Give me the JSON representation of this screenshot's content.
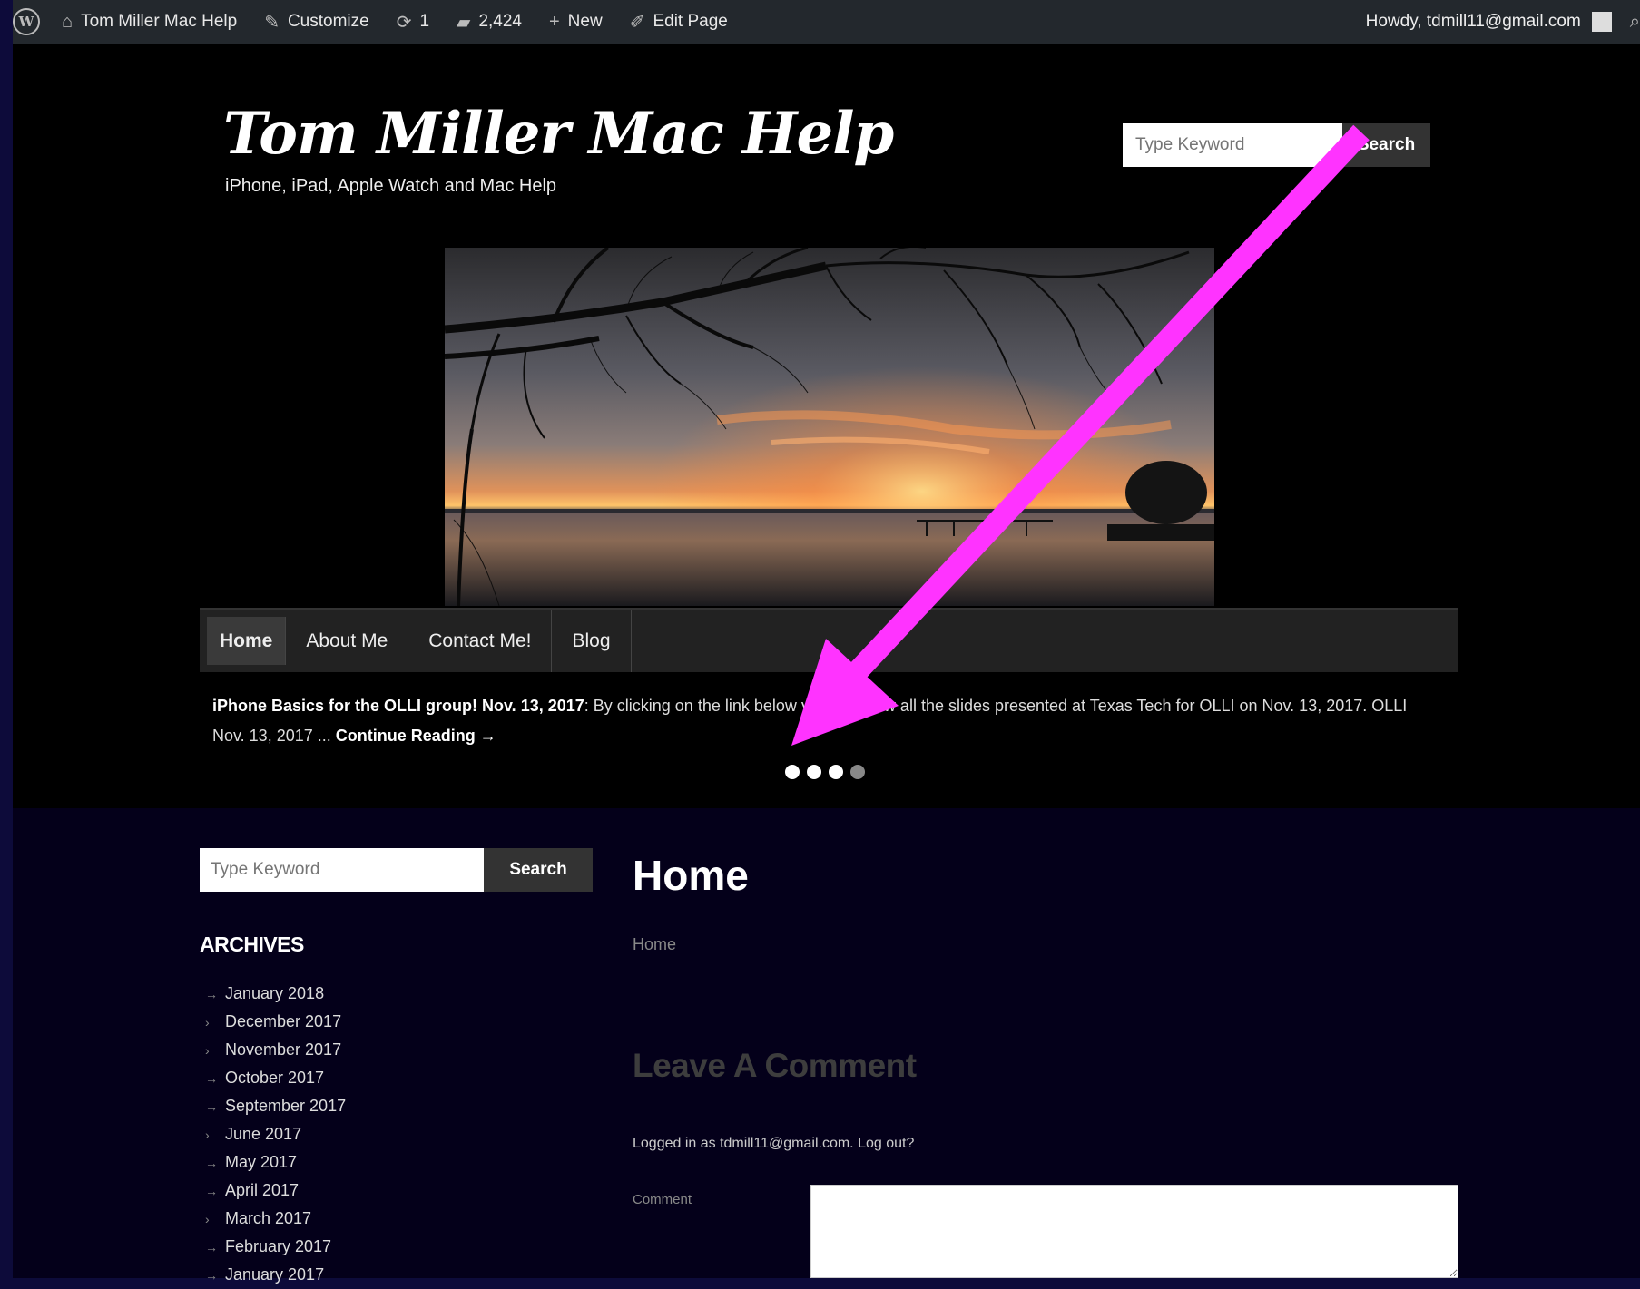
{
  "adminbar": {
    "site_name": "Tom Miller Mac Help",
    "customize": "Customize",
    "updates": "1",
    "comments": "2,424",
    "new": "New",
    "edit_page": "Edit Page",
    "howdy": "Howdy, tdmill11@gmail.com"
  },
  "header": {
    "title": "Tom Miller Mac Help",
    "tagline": "iPhone, iPad, Apple Watch and Mac Help",
    "search_placeholder": "Type Keyword",
    "search_button": "Search"
  },
  "nav": {
    "items": [
      {
        "label": "Home"
      },
      {
        "label": "About Me"
      },
      {
        "label": "Contact Me!"
      },
      {
        "label": "Blog"
      }
    ]
  },
  "slider": {
    "headline": "iPhone Basics for the OLLI group! Nov. 13, 2017",
    "body": ": By clicking on the link below you can view all the slides presented at Texas Tech for OLLI on Nov. 13, 2017.   OLLI Nov. 13, 2017   ...",
    "continue": "Continue Reading →",
    "dots_total": 4,
    "dots_active": 3
  },
  "sidebar": {
    "search_placeholder": "Type Keyword",
    "search_button": "Search",
    "archives_heading": "ARCHIVES",
    "archives": [
      "January 2018",
      "December 2017",
      "November 2017",
      "October 2017",
      "September 2017",
      "June 2017",
      "May 2017",
      "April 2017",
      "March 2017",
      "February 2017",
      "January 2017"
    ]
  },
  "main": {
    "title": "Home",
    "breadcrumb": "Home",
    "leave_comment": "Leave A Comment",
    "logged_in": "Logged in as tdmill11@gmail.com. Log out?",
    "comment_label": "Comment"
  },
  "colors": {
    "annotation_arrow": "#ff33ff",
    "page_bg": "#04001a",
    "header_bg": "#000000"
  }
}
